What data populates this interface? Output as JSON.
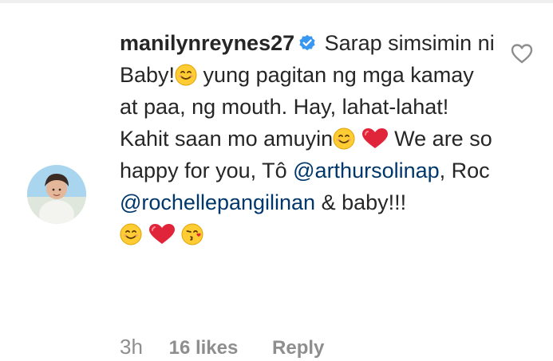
{
  "comment": {
    "username": "manilynreynes27",
    "verified": true,
    "segments": [
      " Sarap simsimin ni Baby!",
      " yung pagitan ng mga kamay at paa, ng mouth. Hay, lahat-lahat! Kahit saan mo amuyin",
      " We are so happy for you, Tô ",
      "@arthursolinap",
      ", Roc ",
      "@rochellepangilinan",
      " & baby!!!"
    ],
    "emojis": [
      "smiling-face",
      "smiling-face",
      "red-heart",
      "smiling-face",
      "red-heart",
      "face-blowing-kiss"
    ]
  },
  "meta": {
    "time": "3h",
    "likes": "16 likes",
    "reply": "Reply"
  },
  "icons": {
    "like": "heart-outline-icon",
    "verified": "verified-badge-icon"
  },
  "colors": {
    "text": "#262626",
    "muted": "#8e8e8e",
    "mention": "#00376b",
    "verified": "#3897f0"
  }
}
